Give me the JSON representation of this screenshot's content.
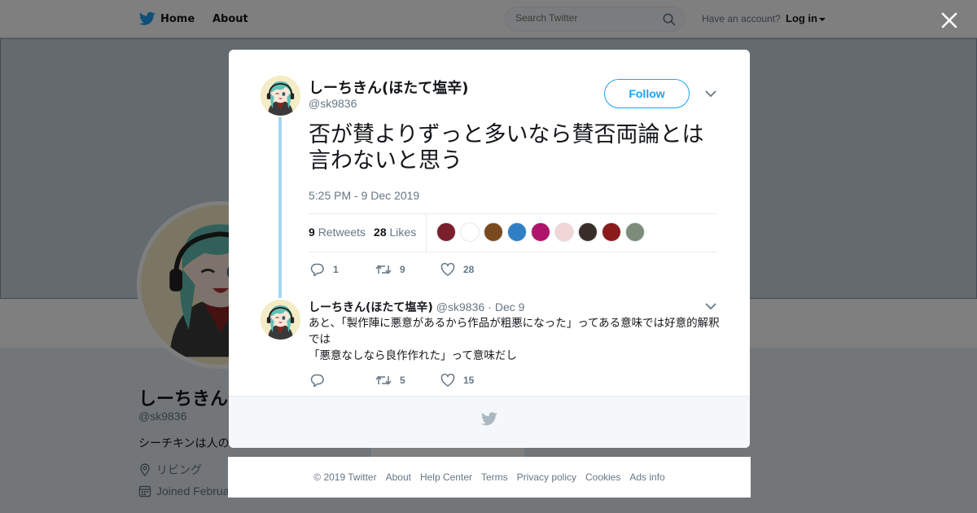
{
  "topbar": {
    "home_label": "Home",
    "about_label": "About",
    "search_placeholder": "Search Twitter",
    "account_prompt": "Have an account?",
    "login_label": "Log in"
  },
  "profile": {
    "name": "しーちきん(",
    "handle": "@sk9836",
    "bio": "シーチキンは人の",
    "location": "リビング",
    "joined": "Joined Februa"
  },
  "tweet": {
    "author_name": "しーちきん(ほたて塩辛)",
    "author_handle": "@sk9836",
    "follow_label": "Follow",
    "text": "否が賛よりずっと多いなら賛否両論とは言わないと思う",
    "timestamp": "5:25 PM - 9 Dec 2019",
    "retweet_count": "9",
    "retweet_label": "Retweets",
    "like_count": "28",
    "like_label": "Likes",
    "actions": {
      "replies": "1",
      "retweets": "9",
      "likes": "28"
    }
  },
  "likers": [
    {
      "color": "#7a1f2b"
    },
    {
      "color": "#ffffff"
    },
    {
      "color": "#7a4a1e"
    },
    {
      "color": "#2f7fc4"
    },
    {
      "color": "#b0136b"
    },
    {
      "color": "#f1d6d6"
    },
    {
      "color": "#3a2e2a"
    },
    {
      "color": "#8c1b1b"
    },
    {
      "color": "#7d8c7a"
    }
  ],
  "reply": {
    "author_name": "しーちきん(ほたて塩辛)",
    "author_handle": "@sk9836",
    "date": "Dec 9",
    "line1": "あと、「製作陣に悪意があるから作品が粗悪になった」ってある意味では好意的解釈では",
    "line2": "「悪意なしなら良作作れた」って意味だし",
    "actions": {
      "replies": "",
      "retweets": "5",
      "likes": "15"
    }
  },
  "footer": {
    "links": [
      "© 2019 Twitter",
      "About",
      "Help Center",
      "Terms",
      "Privacy policy",
      "Cookies",
      "Ads info"
    ]
  },
  "colors": {
    "accent": "#1da1f2",
    "thread": "#a6d6f1",
    "muted": "#657786"
  }
}
